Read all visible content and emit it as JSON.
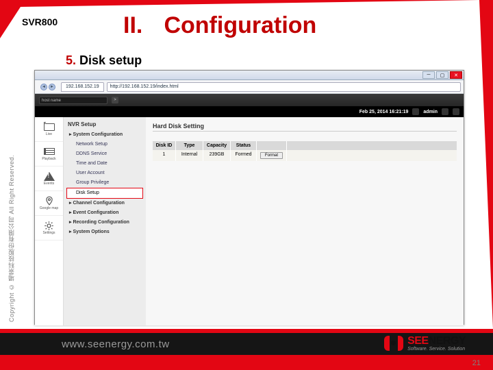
{
  "header": {
    "product": "SVR800",
    "section_roman": "II.",
    "section_title": "Configuration"
  },
  "step": {
    "num": "5.",
    "text": "Disk setup"
  },
  "copyright": "Copyright © 場景科技股份有限公司 All Right Reserved.",
  "browser": {
    "tab": "192.168.152.19",
    "url": "http://192.168.152.19/index.html",
    "host_label": "host name",
    "go": ">",
    "datetime": "Feb 25, 2014 16:21:19",
    "user": "admin"
  },
  "rail": {
    "items": [
      {
        "label": "Live"
      },
      {
        "label": "Playback"
      },
      {
        "label": "Events"
      },
      {
        "label": "Google map"
      },
      {
        "label": "Settings"
      }
    ]
  },
  "tree": {
    "title": "NVR Setup",
    "nodes": [
      {
        "lvl": 1,
        "label": "System Configuration"
      },
      {
        "lvl": 2,
        "label": "Network Setup"
      },
      {
        "lvl": 2,
        "label": "DDNS Service"
      },
      {
        "lvl": 2,
        "label": "Time and Date"
      },
      {
        "lvl": 2,
        "label": "User Account"
      },
      {
        "lvl": 2,
        "label": "Group Privilege"
      },
      {
        "lvl": 2,
        "label": "Disk Setup",
        "sel": true
      },
      {
        "lvl": 1,
        "label": "Channel Configuration"
      },
      {
        "lvl": 1,
        "label": "Event Configuration"
      },
      {
        "lvl": 1,
        "label": "Recording Configuration"
      },
      {
        "lvl": 1,
        "label": "System Options"
      }
    ]
  },
  "content": {
    "title": "Hard Disk Setting",
    "table": {
      "head": [
        "Disk ID",
        "Type",
        "Capacity",
        "Status",
        ""
      ],
      "rows": [
        [
          "1",
          "Internal",
          "239GB",
          "Formed",
          "Format"
        ]
      ]
    }
  },
  "footer": {
    "url": "www.seenergy.com.tw",
    "brand_a": "SEE",
    "brand_b": "NERGY",
    "tag": "Software. Service. Solution"
  },
  "page": "21"
}
